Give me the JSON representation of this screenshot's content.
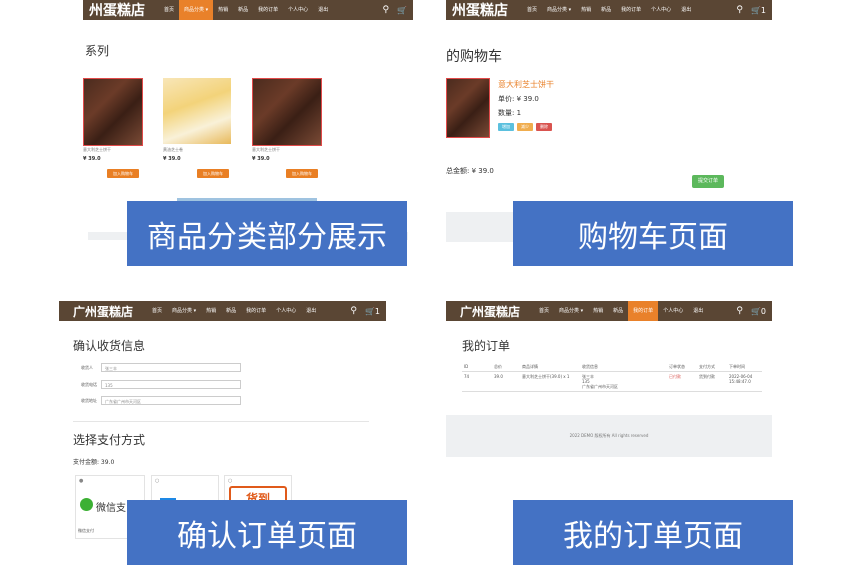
{
  "panels": {
    "category": {
      "brand": "州蛋糕店",
      "nav": [
        "首页",
        "商品分类 ▾",
        "热销",
        "新品",
        "我的订单",
        "个人中心",
        "退出"
      ],
      "heading": "系列",
      "products": [
        {
          "name": "意大利芝士饼干",
          "price": "¥ 39.0",
          "button": "加入购物车"
        },
        {
          "name": "黄油芝士卷",
          "price": "¥ 39.0",
          "button": "加入购物车"
        },
        {
          "name": "意大利芝士饼干",
          "price": "¥ 39.0",
          "button": "加入购物车"
        }
      ],
      "caption": "商品分类部分展示"
    },
    "cart": {
      "brand": "州蛋糕店",
      "nav": [
        "首页",
        "商品分类 ▾",
        "热销",
        "新品",
        "我的订单",
        "个人中心",
        "退出"
      ],
      "cart_count": "1",
      "heading": "的购物车",
      "item_name": "意大利芝士饼干",
      "unit_price": "单价: ¥ 39.0",
      "quantity": "数量: 1",
      "buttons": [
        "增加",
        "减少",
        "删除"
      ],
      "total": "总金额: ¥ 39.0",
      "submit": "提交订单",
      "caption": "购物车页面"
    },
    "confirm": {
      "brand": "广州蛋糕店",
      "nav": [
        "首页",
        "商品分类 ▾",
        "热销",
        "新品",
        "我的订单",
        "个人中心",
        "退出"
      ],
      "cart_count": "1",
      "heading": "确认收货信息",
      "fields": [
        {
          "label": "收货人",
          "value": "张三丰"
        },
        {
          "label": "收货电话",
          "value": "135"
        },
        {
          "label": "收货地址",
          "value": "广东省广州市天河区"
        }
      ],
      "pay_heading": "选择支付方式",
      "pay_amount": "支付金额: 39.0",
      "wechat": "微信支",
      "wechat_caption": "微信支付",
      "cod": "货到",
      "caption": "确认订单页面"
    },
    "orders": {
      "brand": "广州蛋糕店",
      "nav": [
        "首页",
        "商品分类 ▾",
        "热销",
        "新品",
        "我的订单",
        "个人中心",
        "退出"
      ],
      "cart_count": "0",
      "heading": "我的订单",
      "columns": [
        "ID",
        "总价",
        "商品详情",
        "收货信息",
        "订单状态",
        "支付方式",
        "下单时间"
      ],
      "row": {
        "id": "74",
        "total": "39.0",
        "detail": "意大利芝士饼干(39.0) x 1",
        "receiver1": "张三丰",
        "receiver2": "135",
        "receiver3": "广东省广州市天河区",
        "status": "已付款",
        "pay": "货到付款",
        "time1": "2022-06-04",
        "time2": "15:48:47.0"
      },
      "footer": "2022 DEMO 版权所有 All rights reserved",
      "caption": "我的订单页面"
    }
  },
  "colors": {
    "nav": "#5a4634",
    "accent": "#e9812a",
    "banner": "#4472c4"
  }
}
